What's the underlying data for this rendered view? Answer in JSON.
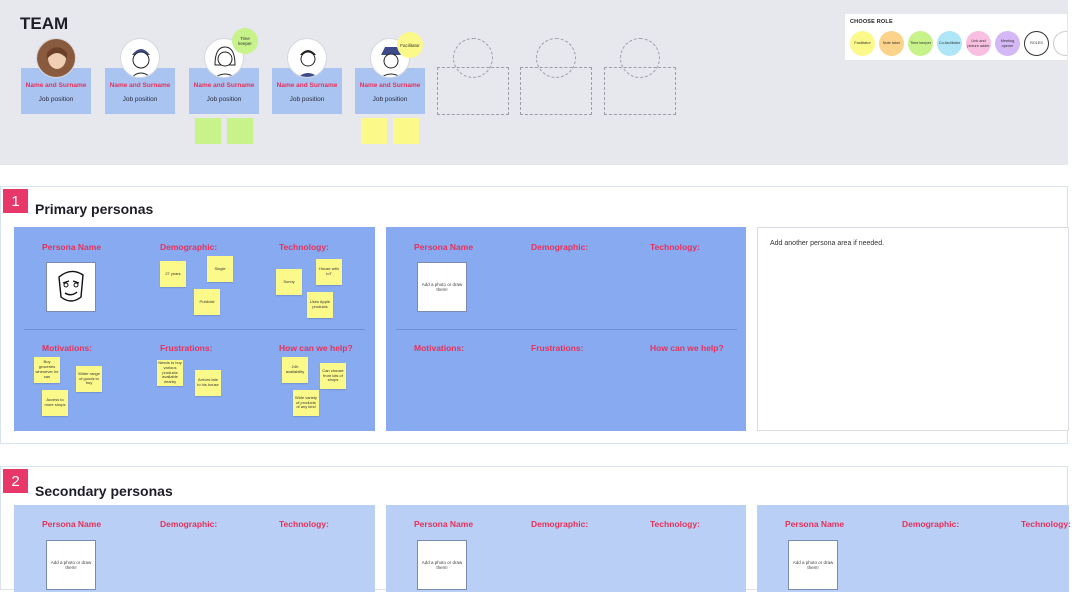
{
  "team": {
    "title": "TEAM",
    "members": [
      {
        "name": "Name and Surname",
        "position": "Job position"
      },
      {
        "name": "Name and Surname",
        "position": "Job position"
      },
      {
        "name": "Name and Surname",
        "position": "Job position",
        "tag": "Time keeper"
      },
      {
        "name": "Name and Surname",
        "position": "Job position"
      },
      {
        "name": "Name and Surname",
        "position": "Job position",
        "tag": "Facilitator"
      }
    ]
  },
  "roles": {
    "title": "CHOOSE ROLE",
    "items": [
      {
        "label": "Facilitator",
        "color": "#fbf98a"
      },
      {
        "label": "Note taker",
        "color": "#fbd38a"
      },
      {
        "label": "Time keeper",
        "color": "#c8f28a"
      },
      {
        "label": "Co-facilitator",
        "color": "#aee6f8"
      },
      {
        "label": "Link and picture adder",
        "color": "#f8bfe0"
      },
      {
        "label": "Meeting opener",
        "color": "#d4b8f5"
      },
      {
        "label": "ROLES",
        "color": "#ffffff"
      }
    ]
  },
  "sections": {
    "primary": {
      "number": "1",
      "title": "Primary personas",
      "headers": {
        "persona": "Persona Name",
        "demographic": "Demographic:",
        "technology": "Technology:",
        "motivations": "Motivations:",
        "frustrations": "Frustrations:",
        "help": "How can we help?"
      },
      "demographic_notes": [
        "27 years",
        "Single",
        "Publicist"
      ],
      "technology_notes": [
        "Sonny",
        "House with IoT",
        "Uses Apple products"
      ],
      "motivation_notes": [
        "Buy groceries whenever he can",
        "Wider range of goods to buy",
        "Access to more shops"
      ],
      "frustration_notes": [
        "Needs to buy various products available nearby",
        "Arrives late to his house"
      ],
      "help_notes": [
        "24h availability",
        "Can choose from lots of shops",
        "Wide variety of products of any kind"
      ],
      "photo_hint": "Add a photo or draw them!",
      "add_hint": "Add another persona area if needed."
    },
    "secondary": {
      "number": "2",
      "title": "Secondary personas",
      "photo_hint": "Add a photo or draw them!"
    }
  }
}
